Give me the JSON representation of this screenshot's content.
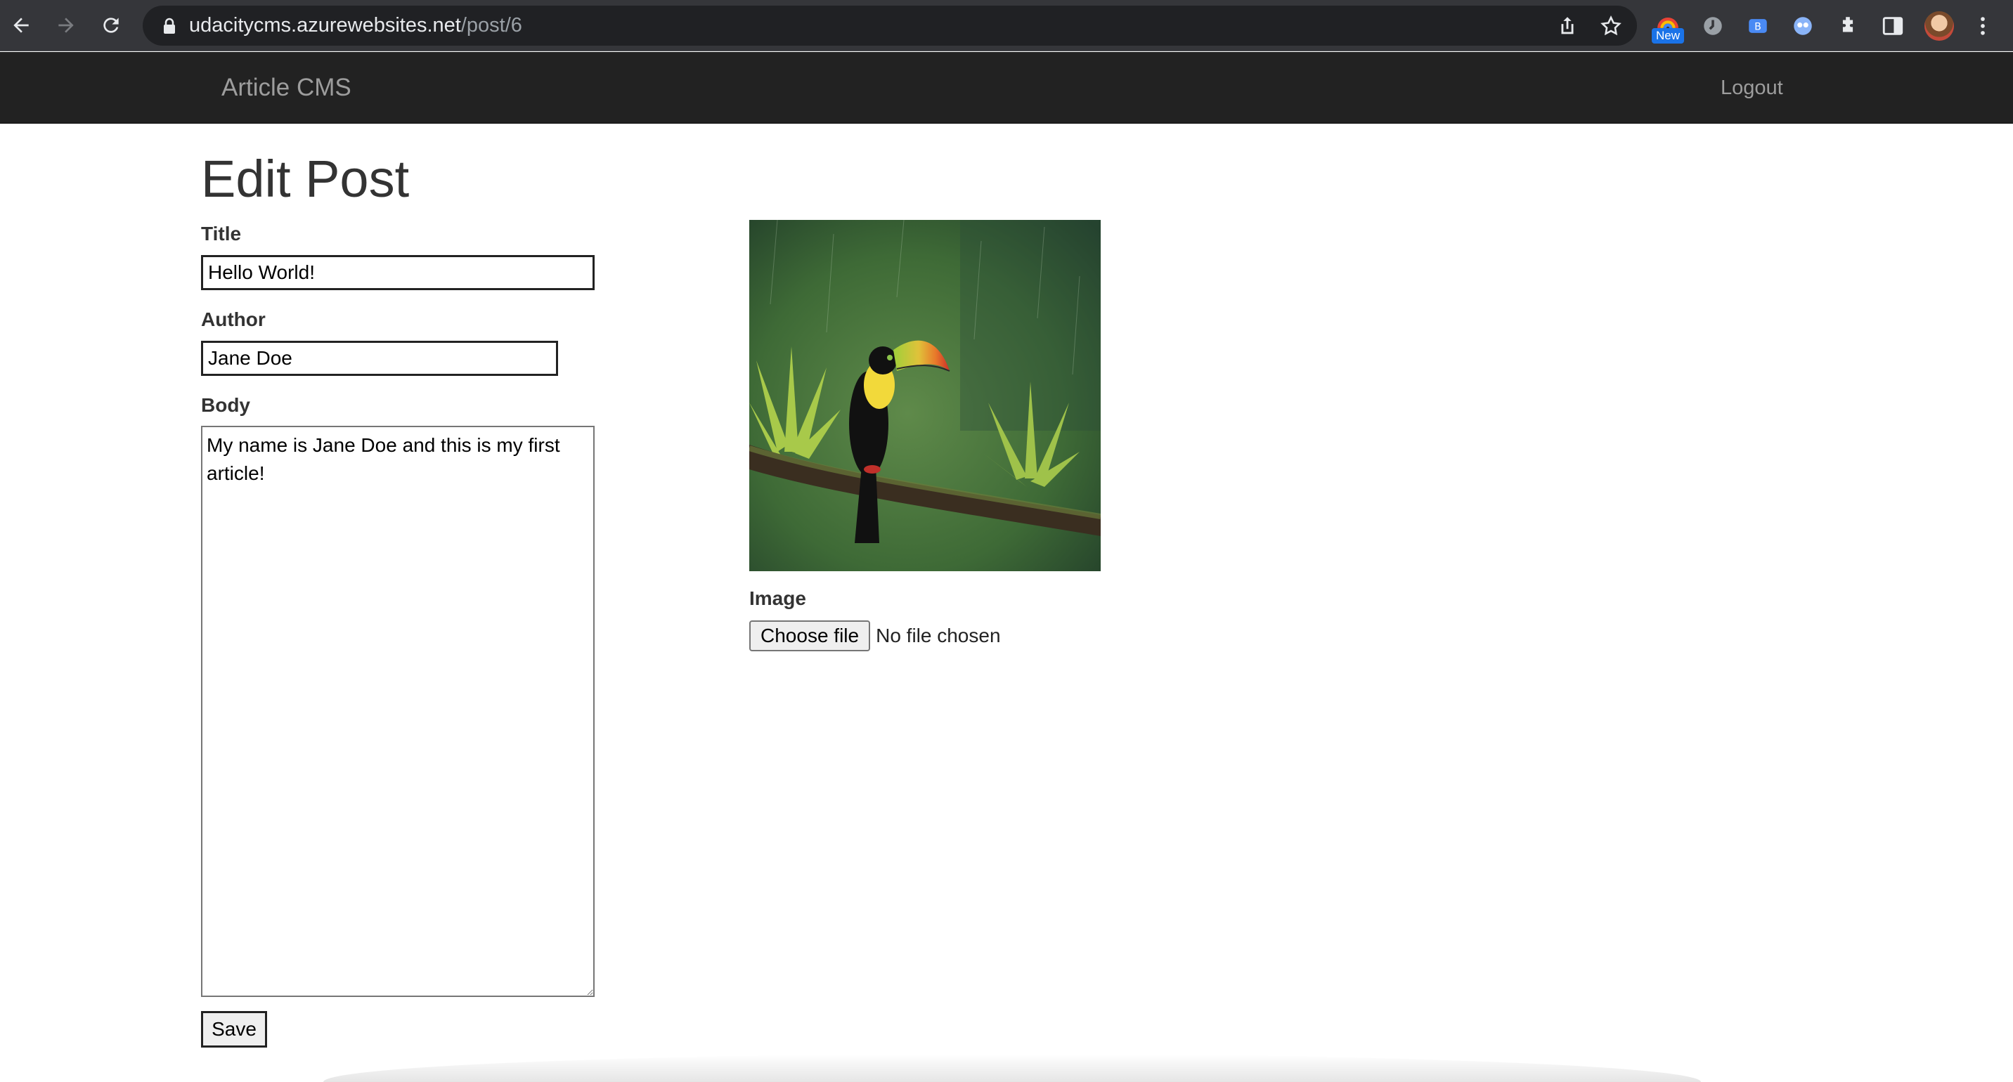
{
  "browser": {
    "url_host": "udacitycms.azurewebsites.net",
    "url_path": "/post/6",
    "extension_badge": "New"
  },
  "navbar": {
    "brand": "Article CMS",
    "logout_label": "Logout"
  },
  "page": {
    "title": "Edit Post"
  },
  "form": {
    "title_label": "Title",
    "title_value": "Hello World!",
    "author_label": "Author",
    "author_value": "Jane Doe",
    "body_label": "Body",
    "body_value": "My name is Jane Doe and this is my first article!",
    "image_label": "Image",
    "choose_file_label": "Choose file",
    "no_file_text": "No file chosen",
    "save_label": "Save"
  },
  "colors": {
    "chrome_bg": "#35363a",
    "omnibox_bg": "#202124",
    "navbar_bg": "#222222",
    "navbar_text": "#9d9d9d",
    "heading_text": "#333333"
  },
  "icons": [
    "back-arrow-icon",
    "forward-arrow-icon",
    "reload-icon",
    "lock-icon",
    "share-icon",
    "star-icon",
    "puzzle-icon",
    "side-panel-icon",
    "kebab-menu-icon"
  ]
}
